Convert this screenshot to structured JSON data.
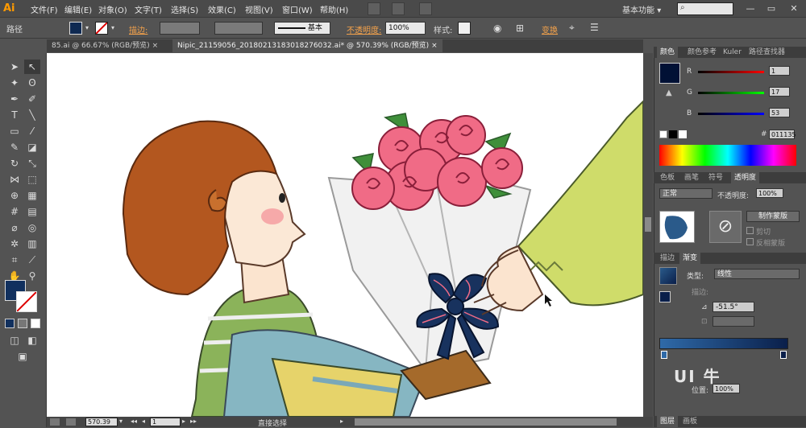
{
  "app": {
    "logo": "Ai",
    "workspace": "基本功能",
    "workspace_arrow": "▾"
  },
  "menu": [
    "文件(F)",
    "编辑(E)",
    "对象(O)",
    "文字(T)",
    "选择(S)",
    "效果(C)",
    "视图(V)",
    "窗口(W)",
    "帮助(H)"
  ],
  "control_bar": {
    "selection_label": "路径",
    "stroke_label": "描边:",
    "stroke_style": "基本",
    "opacity_label": "不透明度:",
    "opacity_value": "100%",
    "style_label": "样式:",
    "transform_label": "变换"
  },
  "tabs": [
    {
      "label": "85.ai @ 66.67% (RGB/预览)",
      "close": "×"
    },
    {
      "label": "Nipic_21159056_20180213183018276032.ai* @ 570.39% (RGB/预览)",
      "close": "×"
    }
  ],
  "status": {
    "zoom": "570.39",
    "artboard": "1",
    "tool": "直接选择"
  },
  "color_panel": {
    "tabs": [
      "颜色",
      "颜色参考",
      "Kuler",
      "路径查找器"
    ],
    "r_label": "R",
    "r_value": "1",
    "g_label": "G",
    "g_value": "17",
    "b_label": "B",
    "b_value": "53",
    "hex_prefix": "#",
    "hex": "011135",
    "fill_color": "#011135"
  },
  "transparency_panel": {
    "tabs": [
      "色板",
      "画笔",
      "符号",
      "透明度"
    ],
    "blend_mode": "正常",
    "opacity_label": "不透明度:",
    "opacity_value": "100%",
    "make_mask_button": "制作蒙版",
    "clip_label": "剪切",
    "invert_label": "反相蒙版"
  },
  "gradient_panel": {
    "tabs": [
      "描边",
      "渐变"
    ],
    "type_label": "类型:",
    "type_value": "线性",
    "stroke_label": "描边:",
    "angle_value": "-51.5°",
    "position_label": "位置:",
    "position_value": "100%",
    "gradient_end_color": "#0a1f4a"
  },
  "layers_panel": {
    "tabs": [
      "图层",
      "画板"
    ]
  },
  "watermark": {
    "text": "UI 牛"
  }
}
